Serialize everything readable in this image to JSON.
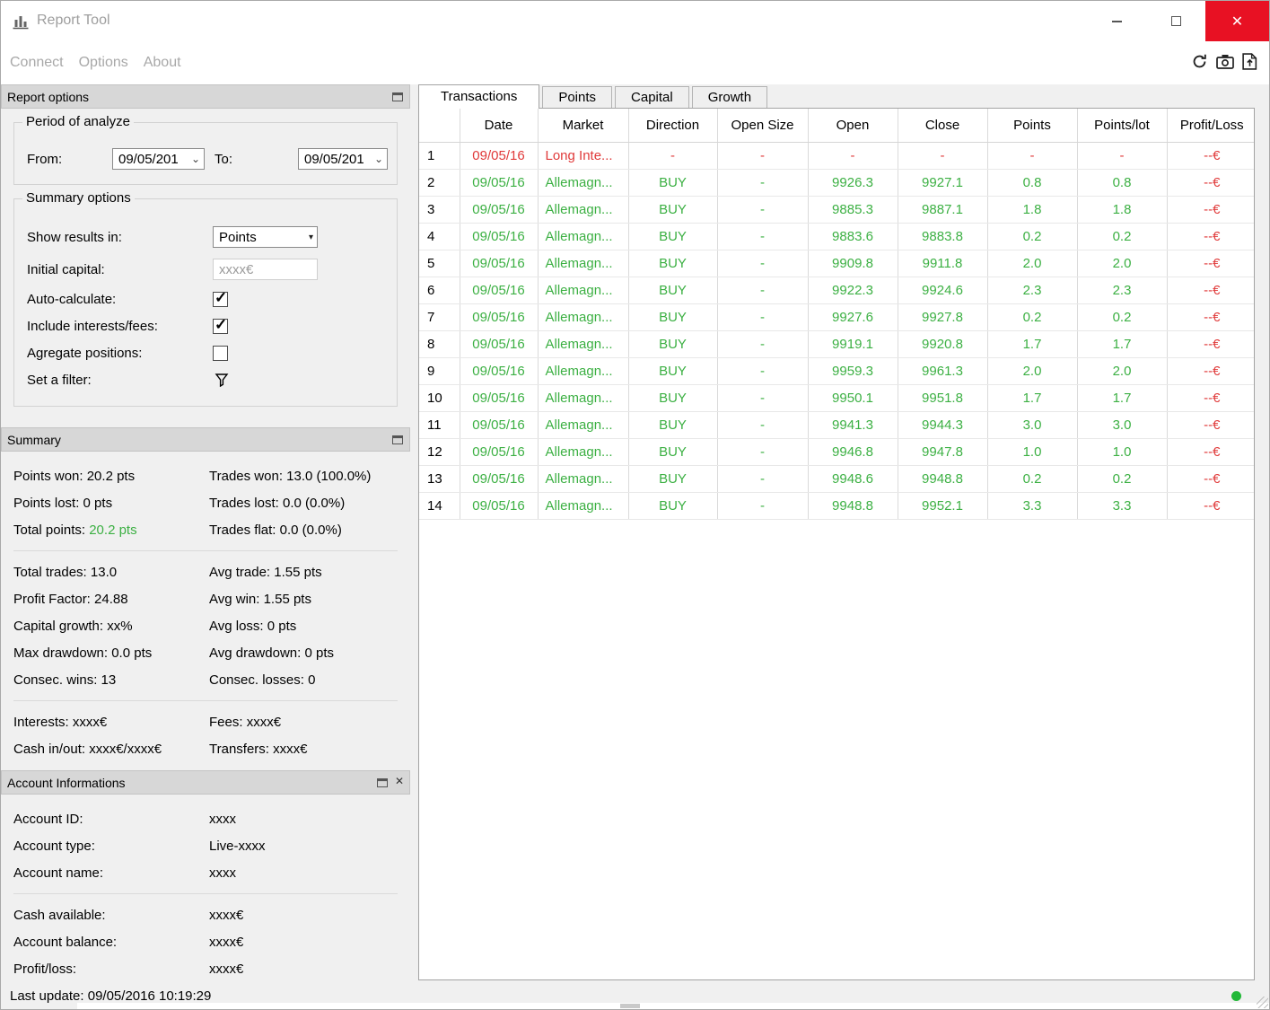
{
  "window": {
    "title": "Report Tool",
    "status_text": "Last update: 09/05/2016 10:19:29"
  },
  "icons": {
    "close": "✕",
    "close_small": "✕",
    "chevron": "⌄",
    "chevron_solid": "▾",
    "checkmark": "✓",
    "toolbar": [
      "refresh-icon",
      "camera-icon",
      "export-icon"
    ],
    "panel_header": [
      "float-panel-icon"
    ],
    "filter": "funnel-icon",
    "app": "bar-chart-icon"
  },
  "colors": {
    "positive": "#3cb043",
    "negative": "#e03a3a",
    "close_button": "#e81123",
    "status_dot": "#22b838",
    "panel_header_bg": "#d7d7d7"
  },
  "menu": {
    "items": [
      {
        "label": "Connect"
      },
      {
        "label": "Options"
      },
      {
        "label": "About"
      }
    ]
  },
  "tabs": [
    {
      "label": "Transactions",
      "state": "active"
    },
    {
      "label": "Points",
      "state": ""
    },
    {
      "label": "Capital",
      "state": ""
    },
    {
      "label": "Growth",
      "state": ""
    }
  ],
  "report_options": {
    "title": "Report options",
    "period": {
      "legend": "Period of analyze",
      "from_label": "From:",
      "from_value": "09/05/201",
      "to_label": "To:",
      "to_value": "09/05/201"
    },
    "options": {
      "legend": "Summary options",
      "show_results_label": "Show results in:",
      "show_results_value": "Points",
      "initial_capital_label": "Initial capital:",
      "initial_capital_placeholder": "xxxx€",
      "auto_calculate_label": "Auto-calculate:",
      "auto_calculate_checked": true,
      "include_fees_label": "Include interests/fees:",
      "include_fees_checked": true,
      "aggregate_label": "Agregate positions:",
      "aggregate_checked": false,
      "filter_label": "Set a filter:"
    }
  },
  "summary": {
    "title": "Summary",
    "groups": [
      [
        {
          "left_label": "Points won:",
          "left_value": "20.2 pts",
          "left_value_class": "",
          "right_label": "Trades won:",
          "right_value": "13.0 (100.0%)",
          "right_value_class": ""
        },
        {
          "left_label": "Points lost:",
          "left_value": "0 pts",
          "left_value_class": "",
          "right_label": "Trades lost:",
          "right_value": "0.0 (0.0%)",
          "right_value_class": ""
        },
        {
          "left_label": "Total points:",
          "left_value": "20.2 pts",
          "left_value_class": "green",
          "right_label": "Trades flat:",
          "right_value": "0.0 (0.0%)",
          "right_value_class": ""
        }
      ],
      [
        {
          "left_label": "Total trades:",
          "left_value": "13.0",
          "left_value_class": "",
          "right_label": "Avg trade:",
          "right_value": "1.55 pts",
          "right_value_class": ""
        },
        {
          "left_label": "Profit Factor:",
          "left_value": "24.88",
          "left_value_class": "",
          "right_label": "Avg win:",
          "right_value": "1.55 pts",
          "right_value_class": ""
        },
        {
          "left_label": "Capital growth:",
          "left_value": "xx%",
          "left_value_class": "",
          "right_label": "Avg loss:",
          "right_value": "0 pts",
          "right_value_class": ""
        },
        {
          "left_label": "Max drawdown:",
          "left_value": "0.0 pts",
          "left_value_class": "",
          "right_label": "Avg drawdown:",
          "right_value": "0 pts",
          "right_value_class": ""
        },
        {
          "left_label": "Consec. wins:",
          "left_value": "13",
          "left_value_class": "",
          "right_label": "Consec. losses:",
          "right_value": "0",
          "right_value_class": ""
        }
      ],
      [
        {
          "left_label": "Interests:",
          "left_value": "xxxx€",
          "left_value_class": "",
          "right_label": "Fees:",
          "right_value": "xxxx€",
          "right_value_class": ""
        },
        {
          "left_label": "Cash in/out:",
          "left_value": "xxxx€/xxxx€",
          "left_value_class": "",
          "right_label": "Transfers:",
          "right_value": "xxxx€",
          "right_value_class": ""
        }
      ]
    ]
  },
  "account": {
    "title": "Account Informations",
    "groups": [
      [
        {
          "label": "Account ID:",
          "value": "xxxx"
        },
        {
          "label": "Account type:",
          "value": "Live-xxxx"
        },
        {
          "label": "Account name:",
          "value": "xxxx"
        }
      ],
      [
        {
          "label": "Cash available:",
          "value": "xxxx€"
        },
        {
          "label": "Account balance:",
          "value": "xxxx€"
        },
        {
          "label": "Profit/loss:",
          "value": "xxxx€"
        }
      ]
    ]
  },
  "transactions": {
    "columns": [
      "Date",
      "Market",
      "Direction",
      "Open Size",
      "Open",
      "Close",
      "Points",
      "Points/lot",
      "Profit/Loss"
    ],
    "rows": [
      {
        "num": "1",
        "date": "09/05/16",
        "market": "Long Inte...",
        "direction": "-",
        "open_size": "-",
        "open": "-",
        "close": "-",
        "points": "-",
        "points_lot": "-",
        "profit_loss": "--€",
        "type": "loss"
      },
      {
        "num": "2",
        "date": "09/05/16",
        "market": "Allemagn...",
        "direction": "BUY",
        "open_size": "-",
        "open": "9926.3",
        "close": "9927.1",
        "points": "0.8",
        "points_lot": "0.8",
        "profit_loss": "--€",
        "type": "win"
      },
      {
        "num": "3",
        "date": "09/05/16",
        "market": "Allemagn...",
        "direction": "BUY",
        "open_size": "-",
        "open": "9885.3",
        "close": "9887.1",
        "points": "1.8",
        "points_lot": "1.8",
        "profit_loss": "--€",
        "type": "win"
      },
      {
        "num": "4",
        "date": "09/05/16",
        "market": "Allemagn...",
        "direction": "BUY",
        "open_size": "-",
        "open": "9883.6",
        "close": "9883.8",
        "points": "0.2",
        "points_lot": "0.2",
        "profit_loss": "--€",
        "type": "win"
      },
      {
        "num": "5",
        "date": "09/05/16",
        "market": "Allemagn...",
        "direction": "BUY",
        "open_size": "-",
        "open": "9909.8",
        "close": "9911.8",
        "points": "2.0",
        "points_lot": "2.0",
        "profit_loss": "--€",
        "type": "win"
      },
      {
        "num": "6",
        "date": "09/05/16",
        "market": "Allemagn...",
        "direction": "BUY",
        "open_size": "-",
        "open": "9922.3",
        "close": "9924.6",
        "points": "2.3",
        "points_lot": "2.3",
        "profit_loss": "--€",
        "type": "win"
      },
      {
        "num": "7",
        "date": "09/05/16",
        "market": "Allemagn...",
        "direction": "BUY",
        "open_size": "-",
        "open": "9927.6",
        "close": "9927.8",
        "points": "0.2",
        "points_lot": "0.2",
        "profit_loss": "--€",
        "type": "win"
      },
      {
        "num": "8",
        "date": "09/05/16",
        "market": "Allemagn...",
        "direction": "BUY",
        "open_size": "-",
        "open": "9919.1",
        "close": "9920.8",
        "points": "1.7",
        "points_lot": "1.7",
        "profit_loss": "--€",
        "type": "win"
      },
      {
        "num": "9",
        "date": "09/05/16",
        "market": "Allemagn...",
        "direction": "BUY",
        "open_size": "-",
        "open": "9959.3",
        "close": "9961.3",
        "points": "2.0",
        "points_lot": "2.0",
        "profit_loss": "--€",
        "type": "win"
      },
      {
        "num": "10",
        "date": "09/05/16",
        "market": "Allemagn...",
        "direction": "BUY",
        "open_size": "-",
        "open": "9950.1",
        "close": "9951.8",
        "points": "1.7",
        "points_lot": "1.7",
        "profit_loss": "--€",
        "type": "win"
      },
      {
        "num": "11",
        "date": "09/05/16",
        "market": "Allemagn...",
        "direction": "BUY",
        "open_size": "-",
        "open": "9941.3",
        "close": "9944.3",
        "points": "3.0",
        "points_lot": "3.0",
        "profit_loss": "--€",
        "type": "win"
      },
      {
        "num": "12",
        "date": "09/05/16",
        "market": "Allemagn...",
        "direction": "BUY",
        "open_size": "-",
        "open": "9946.8",
        "close": "9947.8",
        "points": "1.0",
        "points_lot": "1.0",
        "profit_loss": "--€",
        "type": "win"
      },
      {
        "num": "13",
        "date": "09/05/16",
        "market": "Allemagn...",
        "direction": "BUY",
        "open_size": "-",
        "open": "9948.6",
        "close": "9948.8",
        "points": "0.2",
        "points_lot": "0.2",
        "profit_loss": "--€",
        "type": "win"
      },
      {
        "num": "14",
        "date": "09/05/16",
        "market": "Allemagn...",
        "direction": "BUY",
        "open_size": "-",
        "open": "9948.8",
        "close": "9952.1",
        "points": "3.3",
        "points_lot": "3.3",
        "profit_loss": "--€",
        "type": "win"
      }
    ]
  }
}
